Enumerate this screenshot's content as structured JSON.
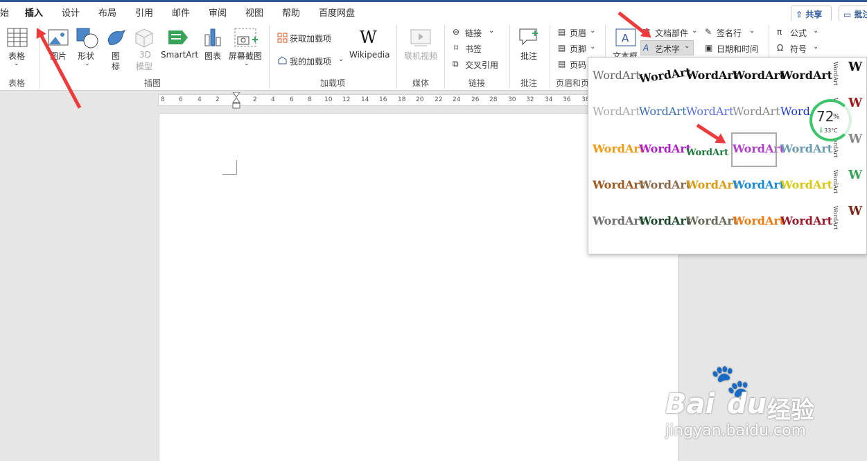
{
  "tabs": [
    "始",
    "插入",
    "设计",
    "布局",
    "引用",
    "邮件",
    "审阅",
    "视图",
    "帮助",
    "百度网盘"
  ],
  "active_tab": "插入",
  "top_buttons": {
    "share": "共享",
    "comment": "批注"
  },
  "ribbon": {
    "table": "表格",
    "picture": "图片",
    "shapes": "形状",
    "icons_line1": "图",
    "icons_line2": "标",
    "model3d_line1": "3D",
    "model3d_line2": "模型",
    "smartart": "SmartArt",
    "chart": "图表",
    "screenshot": "屏幕截图",
    "get_addins": "获取加载项",
    "my_addins": "我的加载项",
    "wikipedia": "Wikipedia",
    "online_video": "联机视频",
    "link": "链接",
    "bookmark": "书签",
    "cross_ref": "交叉引用",
    "comment": "批注",
    "header": "页眉",
    "footer": "页脚",
    "page_number": "页码",
    "textbox": "文本框",
    "quick_parts": "文档部件",
    "wordart": "艺术字",
    "signature": "签名行",
    "datetime": "日期和时间",
    "equation": "公式",
    "symbol": "符号"
  },
  "groups": {
    "tables": "表格",
    "illustrations": "插图",
    "addins": "加载项",
    "media": "媒体",
    "links": "链接",
    "comments": "批注",
    "header_footer": "页眉和页"
  },
  "ruler": {
    "left": [
      "8",
      "6",
      "4",
      "2"
    ],
    "right": [
      "2",
      "4",
      "6",
      "8",
      "10",
      "12",
      "14",
      "16",
      "18",
      "20",
      "22",
      "24",
      "26",
      "28",
      "30",
      "32",
      "34",
      "36",
      "38"
    ]
  },
  "wordart_gallery": {
    "sample": "WordArt",
    "styles": [
      {
        "color": "#666666"
      },
      {
        "color": "#111111"
      },
      {
        "color": "#111111"
      },
      {
        "color": "#111111"
      },
      {
        "color": "#111111"
      },
      {
        "color": "#aaaaaa"
      },
      {
        "color": "#3a6fb0"
      },
      {
        "color": "#5a6fe0"
      },
      {
        "color": "#888888"
      },
      {
        "color": "#1a3bd6"
      },
      {
        "color": "#f09a10"
      },
      {
        "color": "#b020c8"
      },
      {
        "color": "#1a7a3a"
      },
      {
        "color": "#b040c8"
      },
      {
        "color": "#6a9ab0"
      },
      {
        "color": "#a05a20"
      },
      {
        "color": "#8a6a4a"
      },
      {
        "color": "#d89a10"
      },
      {
        "color": "#1a8ad8"
      },
      {
        "color": "#d8c810"
      },
      {
        "color": "#707070"
      },
      {
        "color": "#1a4a2a"
      },
      {
        "color": "#6a6a5a"
      },
      {
        "color": "#f07a10"
      },
      {
        "color": "#9a1a2a"
      }
    ],
    "selected_index": 13,
    "side_column": {
      "w_label": "W",
      "vertical_text": "WordArt"
    }
  },
  "widget": {
    "percent": "72",
    "percent_unit": "%",
    "temperature": "33°C"
  },
  "watermark": {
    "brand": "Bai",
    "brand2": "du",
    "site_cn": "经验",
    "site_url": "jingyan.baidu.com"
  },
  "colors": {
    "accent": "#2b579a",
    "arrow": "#ee3a3a",
    "widget_ring": "#3cc46b"
  }
}
